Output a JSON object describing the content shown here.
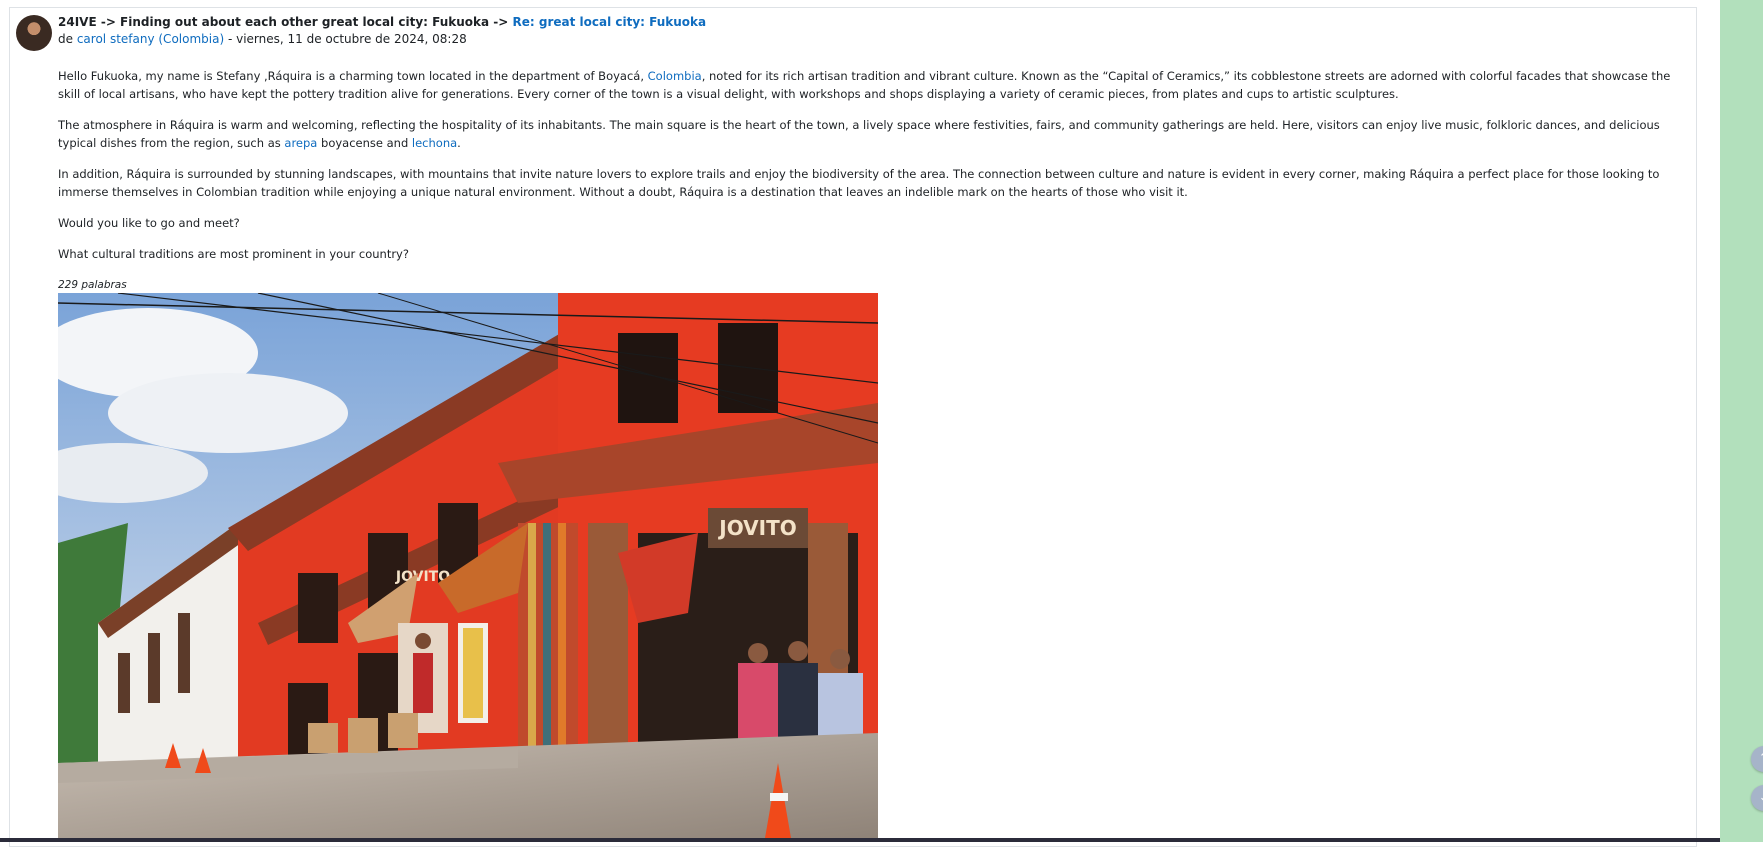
{
  "post": {
    "breadcrumb_forum": "24IVE",
    "sep1": " -> ",
    "breadcrumb_discussion": "Finding out about each other great local city: Fukuoka",
    "sep2": " -> ",
    "subject_link": "Re: great local city: Fukuoka",
    "by_prefix": "de ",
    "author": "carol stefany (Colombia)",
    "date": " - viernes, 11 de octubre de 2024, 08:28"
  },
  "body": {
    "p1_a": "Hello Fukuoka, my name is Stefany ,Ráquira is a charming town located in the department of Boyacá, ",
    "p1_link": "Colombia",
    "p1_b": ", noted for its rich artisan tradition and vibrant culture. Known as the “Capital of Ceramics,” its cobblestone streets are adorned with colorful facades that showcase the skill of local artisans, who have kept the pottery tradition alive for generations. Every corner of the town is a visual delight, with workshops and shops displaying a variety of ceramic pieces, from plates and cups to artistic sculptures.",
    "p2_a": "The atmosphere in Ráquira is warm and welcoming, reflecting the hospitality of its inhabitants. The main square is the heart of the town, a lively space where festivities, fairs, and community gatherings are held. Here, visitors can enjoy live music, folkloric dances, and delicious typical dishes from the region, such as ",
    "p2_link1": "arepa",
    "p2_b": " boyacense and ",
    "p2_link2": "lechona",
    "p2_c": ".",
    "p3": "In addition, Ráquira is surrounded by stunning landscapes, with mountains that invite nature lovers to explore trails and enjoy the biodiversity of the area. The connection between culture and nature is evident in every corner, making Ráquira a perfect place for those looking to immerse themselves in Colombian tradition while enjoying a unique natural environment. Without a doubt, Ráquira is a destination that leaves an indelible mark on the hearts of those who visit it.",
    "p4": "Would you like to go and meet?",
    "p5": "What cultural traditions are most prominent in your country?",
    "word_count": "229 palabras"
  },
  "image": {
    "sign_text": "JOVITO",
    "sign_text_small": "JOVITO"
  },
  "side_buttons": {
    "up_icon": "arrow-up-icon",
    "down_icon": "arrow-down-icon"
  }
}
